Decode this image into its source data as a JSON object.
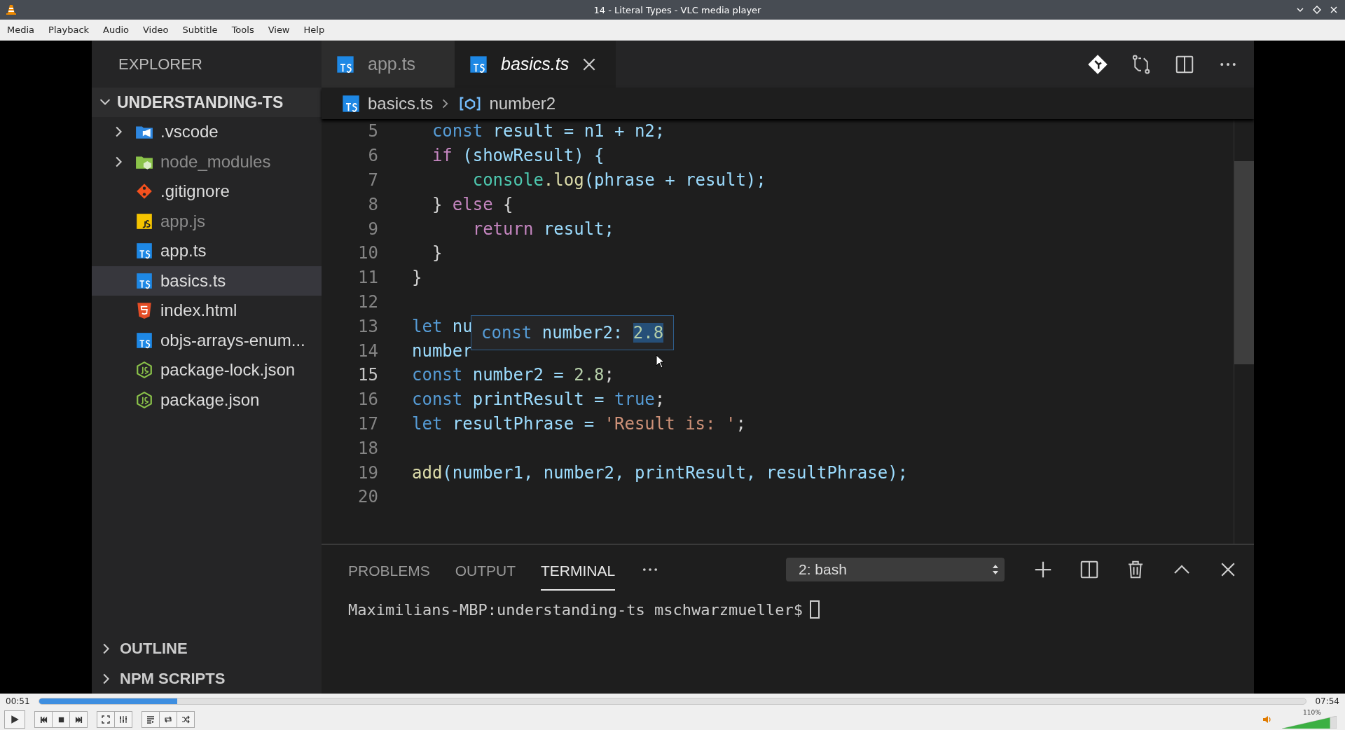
{
  "window": {
    "title": "14 - Literal Types - VLC media player"
  },
  "menu": [
    {
      "label": "Media"
    },
    {
      "label": "Playback"
    },
    {
      "label": "Audio"
    },
    {
      "label": "Video"
    },
    {
      "label": "Subtitle"
    },
    {
      "label": "Tools"
    },
    {
      "label": "View"
    },
    {
      "label": "Help"
    }
  ],
  "editor_app": {
    "sidebar": {
      "title": "EXPLORER",
      "root": {
        "label": "UNDERSTANDING-TS",
        "expanded": true,
        "children": [
          {
            "label": ".vscode",
            "kind": "folder",
            "expanded": false,
            "ignored": false,
            "selected": false
          },
          {
            "label": "node_modules",
            "kind": "folder",
            "expanded": false,
            "ignored": true,
            "selected": false
          },
          {
            "label": ".gitignore",
            "kind": "file",
            "ignored": false,
            "selected": false
          },
          {
            "label": "app.js",
            "kind": "file",
            "ignored": true,
            "selected": false
          },
          {
            "label": "app.ts",
            "kind": "file",
            "ignored": false,
            "selected": false
          },
          {
            "label": "basics.ts",
            "kind": "file",
            "ignored": false,
            "selected": true
          },
          {
            "label": "index.html",
            "kind": "file",
            "ignored": false,
            "selected": false
          },
          {
            "label": "objs-arrays-enum...",
            "kind": "file",
            "ignored": false,
            "selected": false
          },
          {
            "label": "package-lock.json",
            "kind": "file",
            "ignored": false,
            "selected": false
          },
          {
            "label": "package.json",
            "kind": "file",
            "ignored": false,
            "selected": false
          }
        ]
      },
      "sections": [
        {
          "label": "OUTLINE",
          "expanded": false
        },
        {
          "label": "NPM SCRIPTS",
          "expanded": false
        }
      ]
    },
    "tabs": [
      {
        "label": "app.ts",
        "selected": false
      },
      {
        "label": "basics.ts",
        "selected": true
      }
    ],
    "breadcrumb": [
      {
        "label": "basics.ts"
      },
      {
        "label": "number2"
      }
    ],
    "code": [
      {
        "number": "5",
        "current": false,
        "tokens": [
          {
            "t": "  const",
            "kind": "keyword"
          },
          {
            "t": " result = n1 + n2;",
            "kind": "var"
          }
        ]
      },
      {
        "number": "6",
        "current": false,
        "tokens": [
          {
            "t": "  if",
            "kind": "control"
          },
          {
            "t": " (showResult) {",
            "kind": "var"
          }
        ]
      },
      {
        "number": "7",
        "current": false,
        "tokens": [
          {
            "t": "      console",
            "kind": "type"
          },
          {
            "t": ".log",
            "kind": "func"
          },
          {
            "t": "(phrase + result);",
            "kind": "var"
          }
        ]
      },
      {
        "number": "8",
        "current": false,
        "tokens": [
          {
            "t": "  }",
            "kind": "plain"
          },
          {
            "t": " else",
            "kind": "control"
          },
          {
            "t": " {",
            "kind": "plain"
          }
        ]
      },
      {
        "number": "9",
        "current": false,
        "tokens": [
          {
            "t": "      return",
            "kind": "control"
          },
          {
            "t": " result;",
            "kind": "var"
          }
        ]
      },
      {
        "number": "10",
        "current": false,
        "tokens": [
          {
            "t": "  }",
            "kind": "plain"
          }
        ]
      },
      {
        "number": "11",
        "current": false,
        "tokens": [
          {
            "t": "}",
            "kind": "plain"
          }
        ]
      },
      {
        "number": "12",
        "current": false
      },
      {
        "number": "13",
        "current": false,
        "tokens": [
          {
            "t": "let",
            "kind": "keyword"
          },
          {
            "t": " nu",
            "kind": "var"
          }
        ]
      },
      {
        "number": "14",
        "current": false,
        "tokens": [
          {
            "t": "number",
            "kind": "var"
          }
        ]
      },
      {
        "number": "15",
        "current": true,
        "tokens": [
          {
            "t": "const",
            "kind": "keyword"
          },
          {
            "t": " number2 = ",
            "kind": "var"
          },
          {
            "t": "2.8",
            "kind": "number"
          },
          {
            "t": ";",
            "kind": "plain"
          }
        ]
      },
      {
        "number": "16",
        "current": false,
        "tokens": [
          {
            "t": "const",
            "kind": "keyword"
          },
          {
            "t": " printResult = ",
            "kind": "var"
          },
          {
            "t": "true",
            "kind": "keyword"
          },
          {
            "t": ";",
            "kind": "plain"
          }
        ]
      },
      {
        "number": "17",
        "current": false,
        "tokens": [
          {
            "t": "let",
            "kind": "keyword"
          },
          {
            "t": " resultPhrase = ",
            "kind": "var"
          },
          {
            "t": "'Result is: '",
            "kind": "string"
          },
          {
            "t": ";",
            "kind": "plain"
          }
        ]
      },
      {
        "number": "18",
        "current": false
      },
      {
        "number": "19",
        "current": false,
        "tokens": [
          {
            "t": "add",
            "kind": "func"
          },
          {
            "t": "(number1, number2, printResult, resultPhrase);",
            "kind": "var"
          }
        ]
      },
      {
        "number": "20",
        "current": false
      }
    ],
    "hover": {
      "tokens": [
        {
          "t": "const",
          "kind": "keyword"
        },
        {
          "t": " number2: ",
          "kind": "var"
        },
        {
          "t": "2.8",
          "kind": "number"
        }
      ]
    },
    "panel": {
      "tabs": [
        {
          "label": "PROBLEMS",
          "selected": false
        },
        {
          "label": "OUTPUT",
          "selected": false
        },
        {
          "label": "TERMINAL",
          "selected": true
        }
      ],
      "terminal_select": "2: bash",
      "terminal_line": "Maximilians-MBP:understanding-ts mschwarzmueller$"
    }
  },
  "player": {
    "elapsed": "00:51",
    "duration": "07:54",
    "level": 0.109,
    "volume": {
      "label": "110%",
      "level": 0.88
    }
  }
}
